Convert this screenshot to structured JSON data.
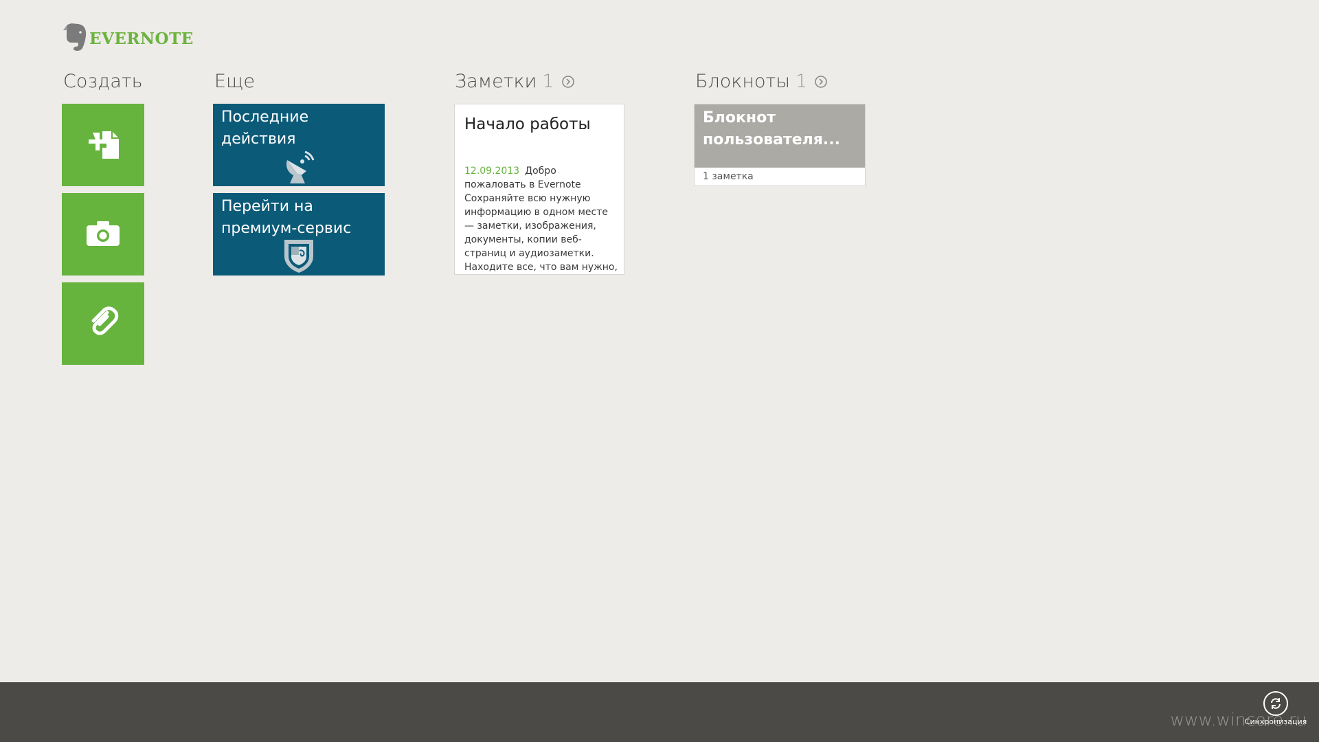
{
  "app": {
    "logo_text": "EVERNOTE"
  },
  "sections": {
    "create": {
      "title": "Создать"
    },
    "more": {
      "title": "Еще"
    },
    "notes": {
      "title": "Заметки",
      "count": "1"
    },
    "notebooks": {
      "title": "Блокноты",
      "count": "1"
    }
  },
  "create_tiles": [
    {
      "icon": "new-note-icon"
    },
    {
      "icon": "camera-icon"
    },
    {
      "icon": "attachment-icon"
    }
  ],
  "more_tiles": [
    {
      "label": "Последние действия",
      "icon": "satellite-dish-icon"
    },
    {
      "label": "Перейти на премиум-сервис",
      "icon": "premium-badge-icon"
    }
  ],
  "note": {
    "title": "Начало работы",
    "date": "12.09.2013",
    "body": "Добро пожаловать в Evernote Сохраняйте всю нужную информацию в одном месте — заметки, изображения, документы, копии веб-страниц и аудиозаметки. Находите все, что вам нужно, при помощи нашей мощной поисковой"
  },
  "notebook": {
    "title": "Блокнот пользователя...",
    "count_label": "1 заметка"
  },
  "appbar": {
    "sync_label": "Синхронизация",
    "watermark": "www.wincore.ru"
  },
  "colors": {
    "green": "#66b33e",
    "blue": "#0b5a78",
    "gray_tile": "#acaaa5",
    "appbar": "#4b4a46"
  }
}
